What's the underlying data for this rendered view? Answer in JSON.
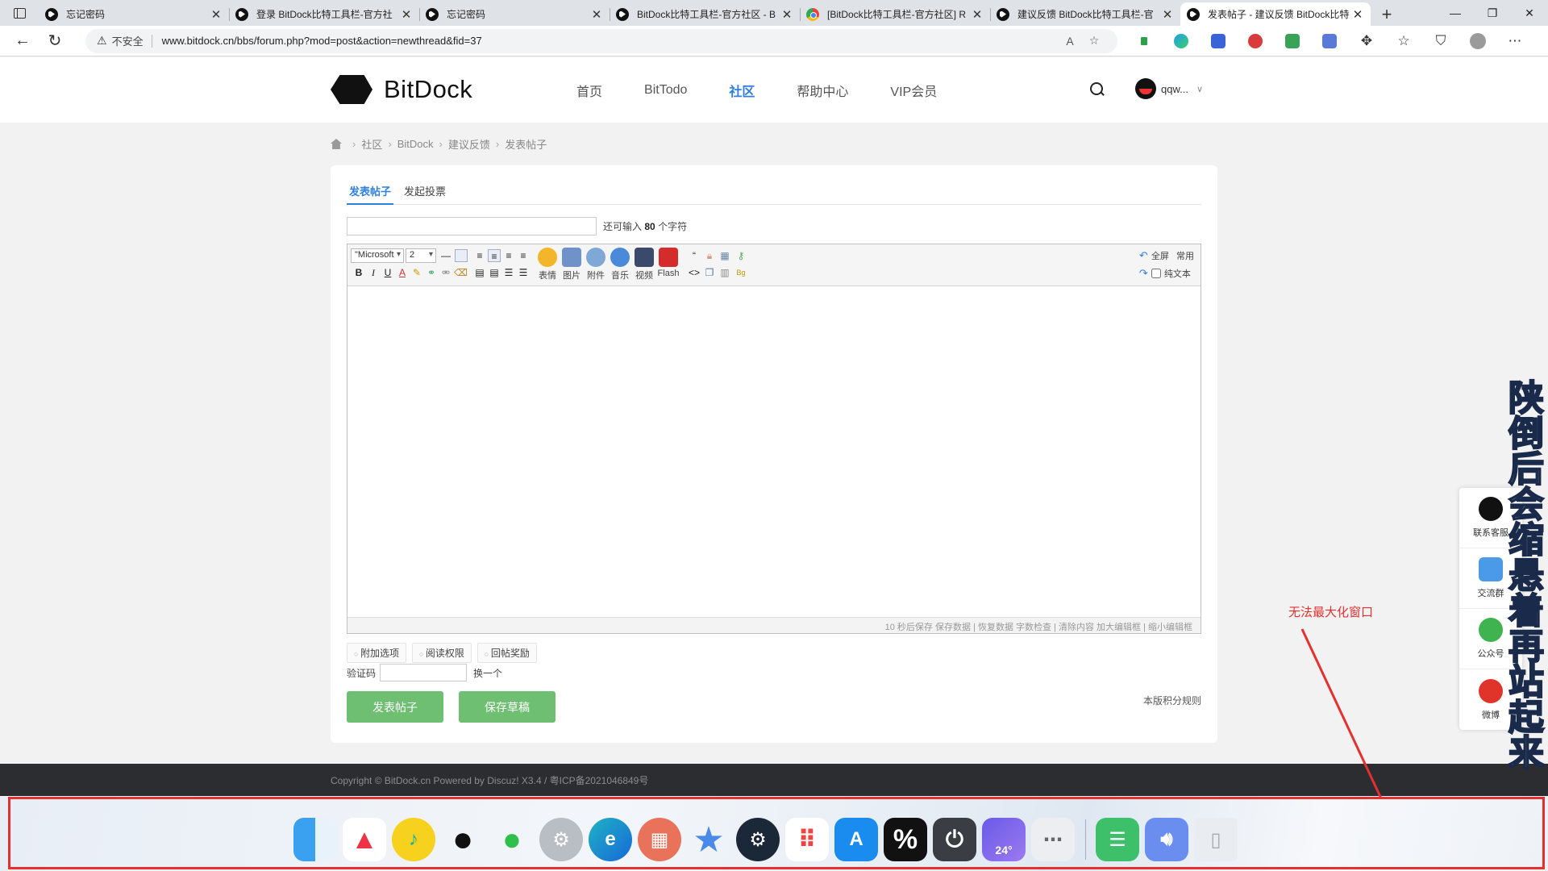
{
  "browser": {
    "tabs": [
      {
        "title": "忘记密码",
        "icon": "bitdock"
      },
      {
        "title": "登录 BitDock比特工具栏-官方社",
        "icon": "bitdock"
      },
      {
        "title": "忘记密码",
        "icon": "bitdock"
      },
      {
        "title": "BitDock比特工具栏-官方社区 - B",
        "icon": "bitdock"
      },
      {
        "title": "[BitDock比特工具栏-官方社区] R",
        "icon": "chrome"
      },
      {
        "title": "建议反馈 BitDock比特工具栏-官",
        "icon": "bitdock"
      },
      {
        "title": "发表帖子 - 建议反馈 BitDock比特",
        "icon": "bitdock",
        "active": true
      }
    ],
    "insecure_label": "不安全",
    "url": "www.bitdock.cn/bbs/forum.php?mod=post&action=newthread&fid=37",
    "win_controls": [
      "—",
      "❐",
      "✕"
    ]
  },
  "site": {
    "logo_text": "BitDock",
    "nav": [
      "首页",
      "BitTodo",
      "社区",
      "帮助中心",
      "VIP会员"
    ],
    "nav_active": "社区",
    "username": "qqw..."
  },
  "breadcrumb": [
    "社区",
    "BitDock",
    "建议反馈",
    "发表帖子"
  ],
  "post": {
    "tabs": [
      "发表帖子",
      "发起投票"
    ],
    "remaining_prefix": "还可输入",
    "remaining_count": "80",
    "remaining_suffix": "个字符",
    "font_select": "\"Microsoft",
    "size_select": "2",
    "tool_big": [
      "表情",
      "图片",
      "附件",
      "音乐",
      "视频",
      "Flash"
    ],
    "tool_right_top": "全屏",
    "tool_right_common": "常用",
    "tool_plaintext": "纯文本",
    "editor_footer": "10 秒后保存 保存数据 | 恢复数据    字数检查 | 清除内容    加大编辑框 | 缩小编辑框",
    "options": [
      "附加选项",
      "阅读权限",
      "回帖奖励"
    ],
    "captcha_label": "验证码",
    "captcha_change": "换一个",
    "submit_button": "发表帖子",
    "draft_button": "保存草稿",
    "rules_link": "本版积分规则"
  },
  "footer": {
    "copyright": "Copyright © BitDock.cn Powered by Discuz! X3.4 / 粤ICP备2021046849号"
  },
  "float_panel": [
    "联系客服",
    "交流群",
    "公众号",
    "微博"
  ],
  "overlay": {
    "vertical_text": "陕倒后会缩悬着再站起来",
    "red_note": "无法最大化窗口",
    "accent": "#e53030"
  },
  "dock": {
    "weather_temp": "24°",
    "apps": [
      "finder",
      "a-app",
      "music",
      "qq",
      "wechat",
      "settings",
      "edge",
      "calculator",
      "star",
      "steam",
      "launchpad",
      "app-store",
      "percent",
      "power",
      "weather",
      "more",
      "notes",
      "speaker",
      "trash"
    ]
  }
}
